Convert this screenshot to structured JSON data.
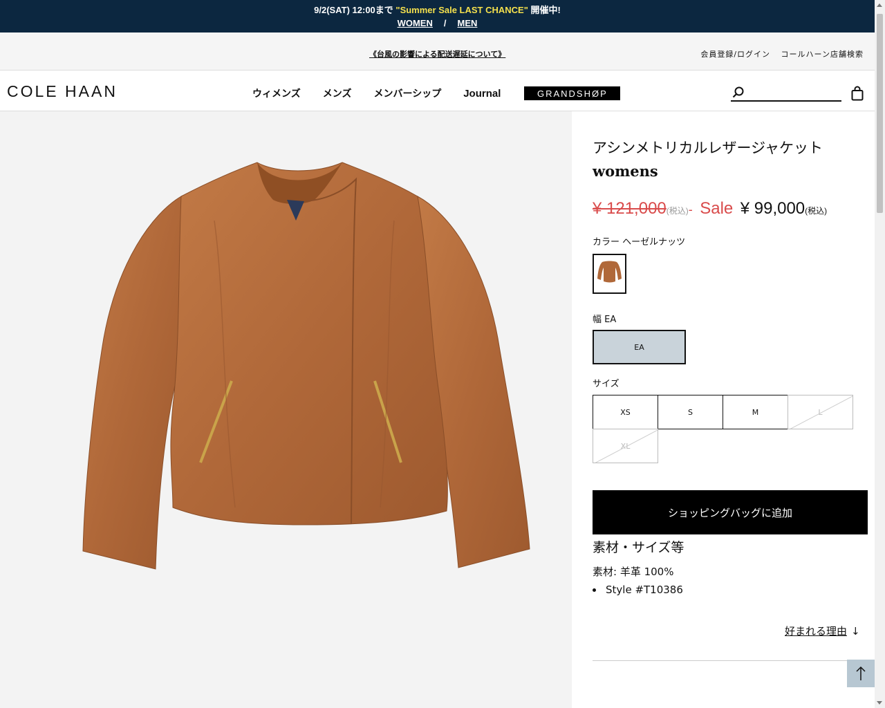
{
  "promo": {
    "prefix": "9/2(SAT) 12:00まで ",
    "highlight": "\"Summer Sale LAST CHANCE\"",
    "suffix": " 開催中!",
    "links": [
      "WOMEN",
      "MEN"
    ],
    "separator": "/"
  },
  "utility": {
    "notice": "《台風の影響による配送遅延について》",
    "login": "会員登録/ログイン",
    "store_search": "コールハーン店舗検索"
  },
  "header": {
    "logo": "COLE HAAN",
    "nav": [
      "ウィメンズ",
      "メンズ",
      "メンバーシップ",
      "Journal"
    ],
    "grandshop": "GRANDSHØP",
    "search_placeholder": ""
  },
  "product": {
    "title": "アシンメトリカルレザージャケット",
    "subtitle": "womens",
    "old_price": "¥ 121,000",
    "tax_note": "(税込)",
    "dash": "-",
    "sale_label": "Sale",
    "new_price": "¥ 99,000",
    "color_label": "カラー ヘーゼルナッツ",
    "width_label": "幅 EA",
    "width_option": "EA",
    "size_label": "サイズ",
    "sizes": [
      {
        "label": "XS",
        "available": true
      },
      {
        "label": "S",
        "available": true
      },
      {
        "label": "M",
        "available": true
      },
      {
        "label": "L",
        "available": false
      },
      {
        "label": "XL",
        "available": false
      }
    ],
    "add_to_bag": "ショッピングバッグに追加",
    "details_heading": "素材・サイズ等",
    "material": "素材: 羊革 100%",
    "style": "Style #T10386",
    "reason_link": "好まれる理由",
    "reason_arrow": "↓"
  },
  "colors": {
    "promo_bg": "#0c2740",
    "promo_highlight": "#f4e04d",
    "sale_red": "#d94b4b",
    "jacket_brown": "#b56a3a",
    "width_selected_bg": "#c9d3da"
  }
}
